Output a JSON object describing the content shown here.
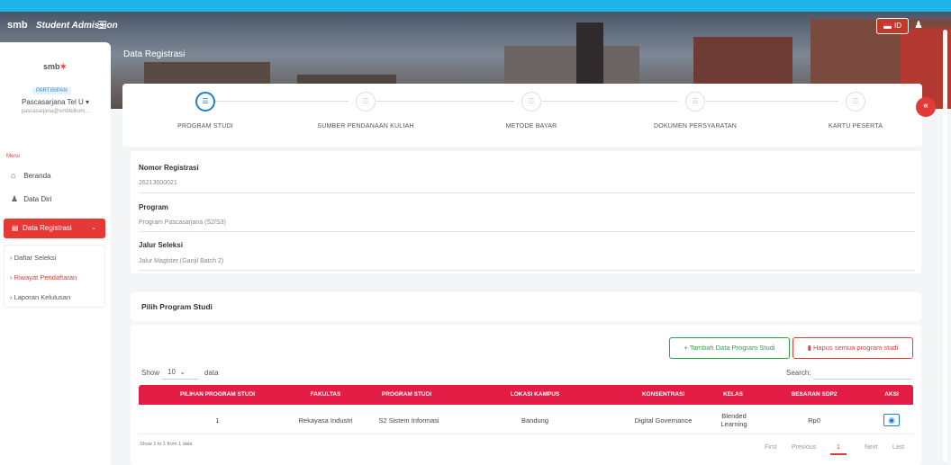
{
  "topbar": {
    "logo": "smb",
    "app_title": "Student Admission",
    "lang_label": "ID"
  },
  "page_heading": "Data Registrasi",
  "sidebar": {
    "logo": "smb",
    "role_badge": "PARTISIPAN",
    "user_name": "Pascasarjana Tel U ▾",
    "user_email": "pascasarjana@smbtelkom...",
    "menu_label": "Menu",
    "items": [
      {
        "label": "Beranda"
      },
      {
        "label": "Data Diri"
      }
    ],
    "active_item": "Data Registrasi",
    "sub_items": [
      {
        "label": "Daftar Seleksi"
      },
      {
        "label": "Riwayat Pendaftaran"
      },
      {
        "label": "Laporan Kelulusan"
      }
    ]
  },
  "stepper": {
    "steps": [
      {
        "label": "PROGRAM STUDI"
      },
      {
        "label": "SUMBER PENDANAAN KULIAH"
      },
      {
        "label": "METODE BAYAR"
      },
      {
        "label": "DOKUMEN PERSYARATAN"
      },
      {
        "label": "KARTU PESERTA"
      }
    ]
  },
  "info": {
    "fields": [
      {
        "label": "Nomor Registrasi",
        "value": "26213000021"
      },
      {
        "label": "Program",
        "value": "Program Pascasarjana (S2/S3)"
      },
      {
        "label": "Jalur Seleksi",
        "value": "Jalur Magister (Ganjil Batch 2)"
      }
    ]
  },
  "pilih": {
    "title": "Pilih Program Studi",
    "add_button": "Tambah Data Program Studi",
    "delete_button": "Hapus semua program studi",
    "show_label": "Show",
    "show_value": "10",
    "data_label": "data",
    "search_label": "Search:",
    "columns": [
      "PILIHAN PROGRAM STUDI",
      "FAKULTAS",
      "PROGRAM STUDI",
      "LOKASI KAMPUS",
      "KONSENTRASI",
      "KELAS",
      "BESARAN SDP2",
      "AKSI"
    ],
    "rows": [
      {
        "pilihan": "1",
        "fakultas": "Rekayasa Industri",
        "program": "S2 Sistem Informasi",
        "lokasi": "Bandung",
        "konsentrasi": "Digital Governance",
        "kelas": "Blended Learning",
        "sdp2": "Rp0"
      }
    ],
    "showing": "Show 1 to 1 from 1 data",
    "pagination": {
      "first": "First",
      "previous": "Previous",
      "current": "1",
      "next": "Next",
      "last": "Last"
    }
  }
}
